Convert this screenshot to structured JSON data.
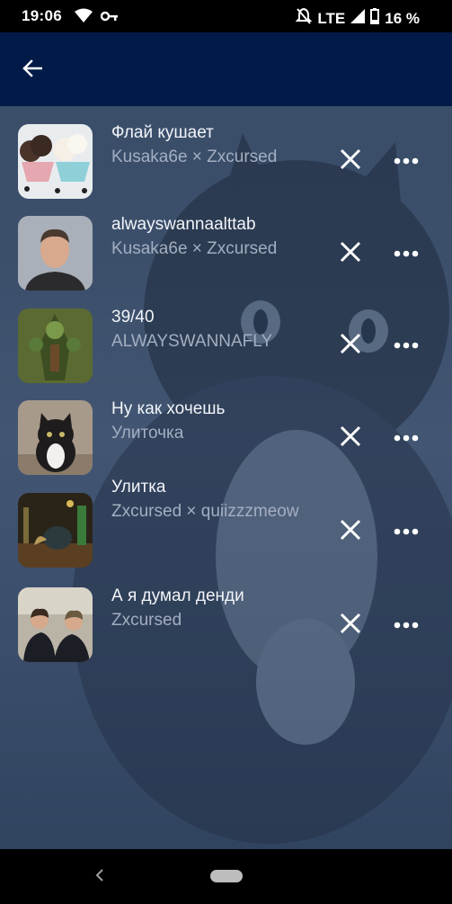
{
  "status_bar": {
    "time": "19:06",
    "network": "LTE",
    "battery": "16 %"
  },
  "app_bar": {
    "back_icon": "arrow-left-icon"
  },
  "tracks": [
    {
      "title": "Флай кушает",
      "artist": "Kusaka6e × Zxcursed",
      "cover": "ice-cream-bowls"
    },
    {
      "title": "alwayswannaalttab",
      "artist": "Kusaka6e × Zxcursed",
      "cover": "man-portrait"
    },
    {
      "title": "39/40",
      "artist": "ALWAYSWANNAFLY",
      "cover": "green-tree-creature"
    },
    {
      "title": "Ну как хочешь",
      "artist": "Улиточка",
      "cover": "black-kitten"
    },
    {
      "title": "Улитка",
      "artist": "Zxcursed × quiizzzmeow",
      "cover": "snail-potion-table"
    },
    {
      "title": "А я думал денди",
      "artist": "Zxcursed",
      "cover": "two-guys-photo"
    }
  ],
  "colors": {
    "app_bar": "#011a47",
    "title_text": "#f2f4f8",
    "artist_text": "#a3aec0"
  }
}
